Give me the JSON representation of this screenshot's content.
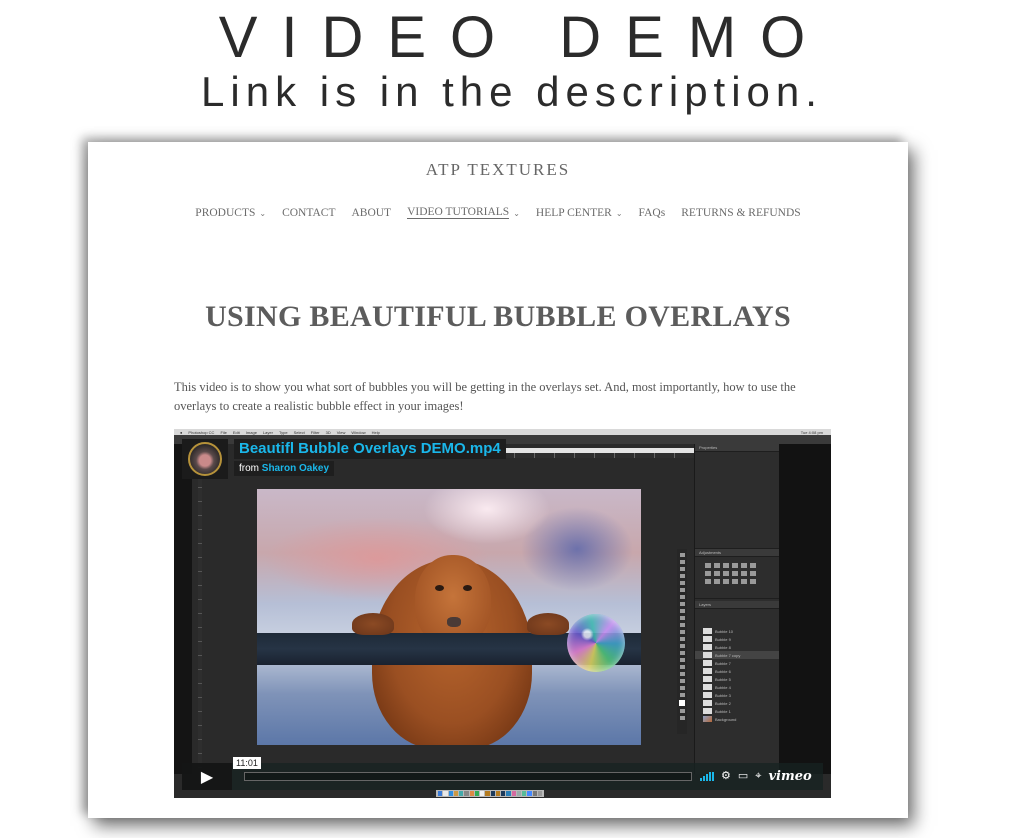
{
  "banner": {
    "title": "VIDEO DEMO",
    "subtitle": "Link is in the description."
  },
  "site": {
    "title": "ATP TEXTURES",
    "nav": [
      {
        "label": "PRODUCTS",
        "dropdown": true,
        "active": false
      },
      {
        "label": "CONTACT",
        "dropdown": false,
        "active": false
      },
      {
        "label": "ABOUT",
        "dropdown": false,
        "active": false
      },
      {
        "label": "VIDEO TUTORIALS",
        "dropdown": true,
        "active": true
      },
      {
        "label": "HELP CENTER",
        "dropdown": true,
        "active": false
      },
      {
        "label": "FAQs",
        "dropdown": false,
        "active": false
      },
      {
        "label": "RETURNS & REFUNDS",
        "dropdown": false,
        "active": false
      }
    ],
    "chevron_icon": "chevron-down-icon"
  },
  "page": {
    "title": "USING BEAUTIFUL BUBBLE OVERLAYS",
    "intro": "This video is to show you what sort of bubbles you will be getting in the overlays set. And, most importantly, how to use the overlays to create a realistic bubble effect in your images!"
  },
  "video": {
    "title": "Beautifl Bubble Overlays DEMO.mp4",
    "byline_prefix": "from",
    "author": "Sharon Oakey",
    "time": "11:01",
    "brand": "vimeo",
    "accent_color": "#1ab7ea",
    "icons": [
      "play-icon",
      "volume-icon",
      "settings-gear-icon",
      "airplay-icon",
      "fullscreen-icon"
    ],
    "photoshop": {
      "menus": [
        "Photoshop CC",
        "File",
        "Edit",
        "Image",
        "Layer",
        "Type",
        "Select",
        "Filter",
        "3D",
        "View",
        "Window",
        "Help"
      ],
      "clock": "Tue 4:08 pm",
      "panels": [
        "Properties",
        "Adjustments",
        "Layers"
      ],
      "layers": [
        "Bubble 10",
        "Bubble 9",
        "Bubble 8",
        "Bubble 7 copy",
        "Bubble 7",
        "Bubble 6",
        "Bubble 5",
        "Bubble 4",
        "Bubble 3",
        "Bubble 2",
        "Bubble 1",
        "Background"
      ],
      "selected_layer": "Bubble 7 copy"
    }
  }
}
